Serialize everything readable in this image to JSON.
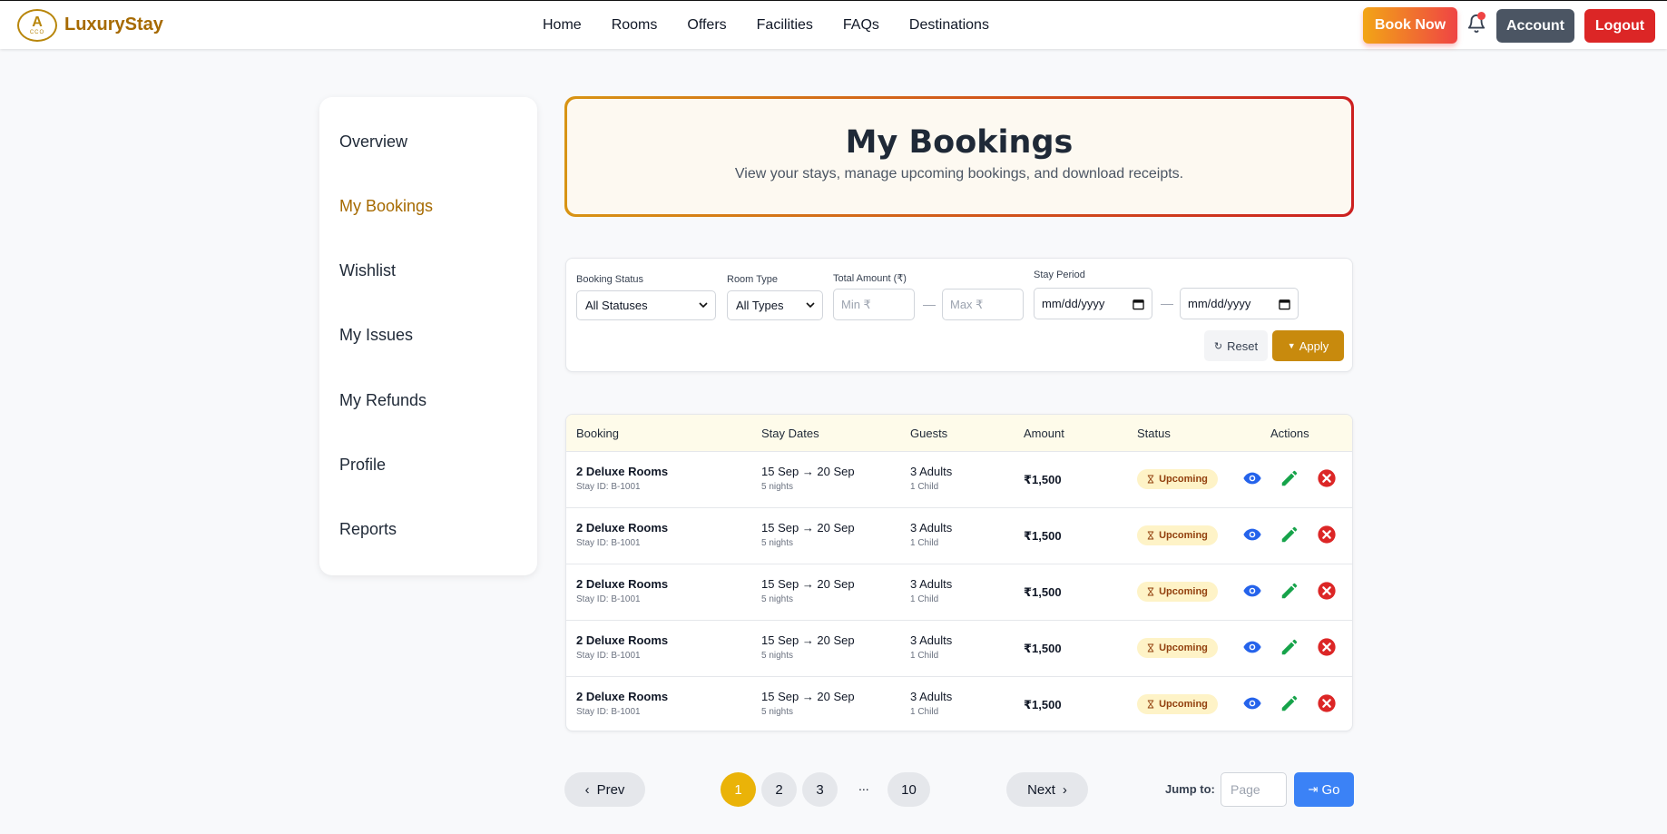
{
  "navbar": {
    "logo_mark": "A",
    "logo_small": "CCO",
    "brand": "LuxuryStay",
    "links": [
      "Home",
      "Rooms",
      "Offers",
      "Facilities",
      "FAQs",
      "Destinations"
    ],
    "book_now": "Book Now",
    "account": "Account",
    "logout": "Logout"
  },
  "sidebar": {
    "items": [
      {
        "label": "Overview",
        "active": false
      },
      {
        "label": "My Bookings",
        "active": true
      },
      {
        "label": "Wishlist",
        "active": false
      },
      {
        "label": "My Issues",
        "active": false
      },
      {
        "label": "My Refunds",
        "active": false
      },
      {
        "label": "Profile",
        "active": false
      },
      {
        "label": "Reports",
        "active": false
      }
    ]
  },
  "hero": {
    "title": "My Bookings",
    "subtitle": "View your stays, manage upcoming bookings, and download receipts."
  },
  "filters": {
    "status_label": "Booking Status",
    "status_value": "All Statuses",
    "room_label": "Room Type",
    "room_value": "All Types",
    "amount_label": "Total Amount (₹)",
    "min_placeholder": "Min ₹",
    "max_placeholder": "Max ₹",
    "period_label": "Stay Period",
    "date_from": "mm/dd/yyyy",
    "date_to": "mm/dd/yyyy",
    "separator": "—",
    "reset": "Reset",
    "apply": "Apply",
    "reset_icon": "↻",
    "apply_icon": "▼"
  },
  "table": {
    "headers": [
      "Booking",
      "Stay Dates",
      "Guests",
      "Amount",
      "Status",
      "Actions"
    ],
    "rows": [
      {
        "room": "2 Deluxe Rooms",
        "stay_id": "Stay ID: B-1001",
        "dates": "15 Sep → 20 Sep",
        "nights": "5 nights",
        "adults": "3 Adults",
        "children": "1 Child",
        "amount": "₹1,500",
        "status": "Upcoming"
      },
      {
        "room": "2 Deluxe Rooms",
        "stay_id": "Stay ID: B-1001",
        "dates": "15 Sep → 20 Sep",
        "nights": "5 nights",
        "adults": "3 Adults",
        "children": "1 Child",
        "amount": "₹1,500",
        "status": "Upcoming"
      },
      {
        "room": "2 Deluxe Rooms",
        "stay_id": "Stay ID: B-1001",
        "dates": "15 Sep → 20 Sep",
        "nights": "5 nights",
        "adults": "3 Adults",
        "children": "1 Child",
        "amount": "₹1,500",
        "status": "Upcoming"
      },
      {
        "room": "2 Deluxe Rooms",
        "stay_id": "Stay ID: B-1001",
        "dates": "15 Sep → 20 Sep",
        "nights": "5 nights",
        "adults": "3 Adults",
        "children": "1 Child",
        "amount": "₹1,500",
        "status": "Upcoming"
      },
      {
        "room": "2 Deluxe Rooms",
        "stay_id": "Stay ID: B-1001",
        "dates": "15 Sep → 20 Sep",
        "nights": "5 nights",
        "adults": "3 Adults",
        "children": "1 Child",
        "amount": "₹1,500",
        "status": "Upcoming"
      }
    ]
  },
  "pagination": {
    "prev": "Prev",
    "next": "Next",
    "pages": [
      "1",
      "2",
      "3",
      "10"
    ],
    "ellipsis": "...",
    "current": "1",
    "jump_label": "Jump to:",
    "jump_placeholder": "Page",
    "go": "Go",
    "go_icon": "⇥",
    "prev_icon": "‹",
    "next_icon": "›"
  },
  "colors": {
    "brand": "#a66a00",
    "accent_gold": "#c88a0d",
    "danger": "#dc2626",
    "view_icon": "#2563eb",
    "edit_icon": "#16a34a"
  },
  "icons": {
    "notification": "bell-icon",
    "view": "eye-icon",
    "edit": "pencil-icon",
    "cancel": "x-circle-icon",
    "status": "hourglass-icon"
  }
}
